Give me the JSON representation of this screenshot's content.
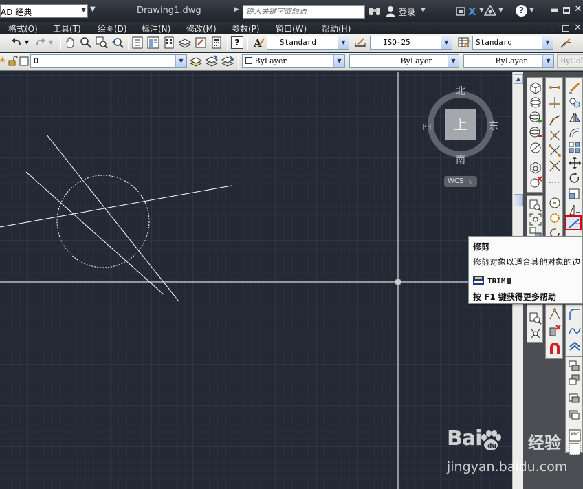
{
  "titlebar": {
    "workspace": "AD 经典",
    "document_title": "Drawing1.dwg",
    "search_placeholder": "键入关键字或短语",
    "login_label": "登录",
    "help_symbol": "?",
    "exchange_symbol": "X"
  },
  "menubar": {
    "items": [
      "格式(O)",
      "工具(T)",
      "绘图(D)",
      "标注(N)",
      "修改(M)",
      "参数(P)",
      "窗口(W)",
      "帮助(H)"
    ]
  },
  "toolbar_styles": {
    "text_style": "Standard",
    "dim_style": "ISO-25",
    "table_style": "Standard",
    "help_symbol": "?"
  },
  "toolbar_layers": {
    "layer_name": "0",
    "color": "ByLayer",
    "linetype": "ByLayer",
    "lineweight": "ByLayer",
    "plotstyle": "ByColor"
  },
  "viewcube": {
    "north": "北",
    "south": "南",
    "west": "西",
    "east": "东",
    "top_face": "上",
    "coord_system": "WCS"
  },
  "tooltip": {
    "title": "修剪",
    "description": "修剪对象以适合其他对象的边",
    "command": "TRIM",
    "help_hint": "按 F1 键获得更多帮助"
  },
  "watermark": {
    "brand": "Bai",
    "product": "经验",
    "url": "jingyan.baidu.com"
  },
  "colors": {
    "canvas_bg": "#242a35",
    "grid_major": "#2f3644",
    "highlight": "#e00000",
    "geometry": "#ffffff"
  }
}
